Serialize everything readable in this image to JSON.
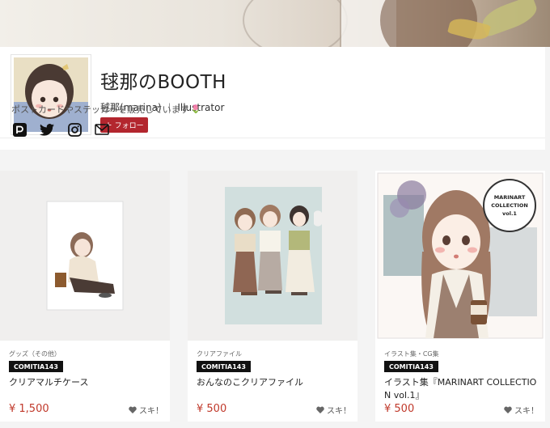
{
  "shop": {
    "title": "毬那のBOOTH",
    "owner": "毬那(marina)",
    "separator": "|",
    "role": "Illustrator",
    "follow_label": "フォロー",
    "bio": "ポストカードやステッカーを販売しています",
    "bio_emoji": "🌷"
  },
  "social_icons": [
    "pixiv-icon",
    "twitter-icon",
    "instagram-icon",
    "mail-icon"
  ],
  "products": [
    {
      "category": "グッズ（その他）",
      "tag": "COMITIA143",
      "name": "クリアマルチケース",
      "price": "¥ 1,500",
      "like_label": "スキ！"
    },
    {
      "category": "クリアファイル",
      "tag": "COMITIA143",
      "name": "おんなのこクリアファイル",
      "price": "¥ 500",
      "like_label": "スキ！"
    },
    {
      "category": "イラスト集・CG集",
      "tag": "COMITIA143",
      "name": "イラスト集『MARINART COLLECTION vol.1』",
      "price": "¥ 500",
      "like_label": "スキ！",
      "seal_line1": "MARINART",
      "seal_line2": "COLLECTION",
      "seal_line3": "vol.1"
    }
  ],
  "colors": {
    "accent": "#b3262e",
    "price": "#c0392b",
    "tag_bg": "#111111"
  }
}
